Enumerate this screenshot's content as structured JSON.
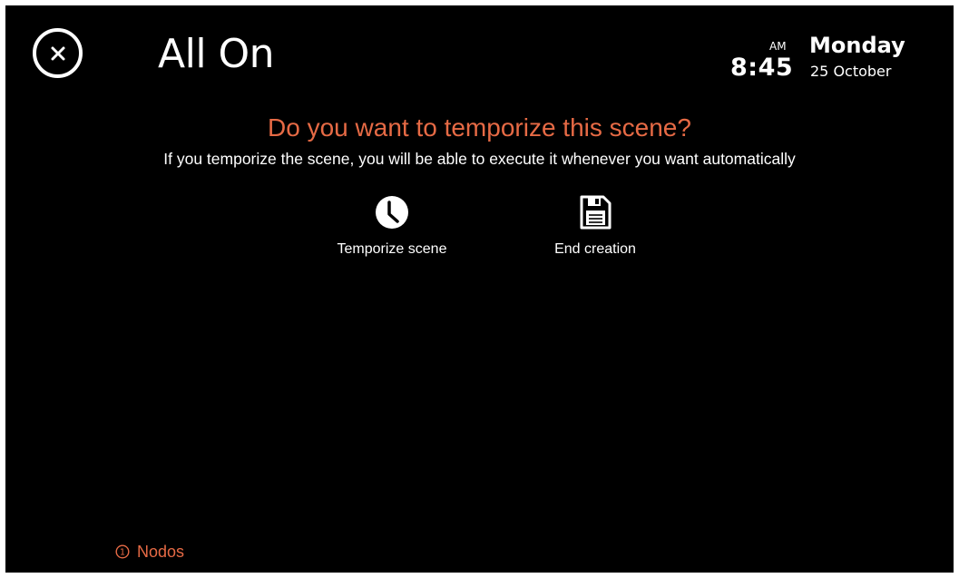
{
  "header": {
    "title": "All On",
    "close_icon": "close-icon"
  },
  "clock": {
    "ampm": "AM",
    "time": "8:45",
    "day": "Monday",
    "date": "25 October"
  },
  "prompt": {
    "question": "Do you want to temporize this scene?",
    "description": "If you temporize the scene, you will be able to execute it whenever you want automatically"
  },
  "actions": [
    {
      "label": "Temporize scene",
      "icon": "clock-icon"
    },
    {
      "label": "End creation",
      "icon": "save-icon"
    }
  ],
  "footer": {
    "nodos_label": "Nodos",
    "nodos_icon": "info-icon"
  },
  "colors": {
    "background": "#000000",
    "accent": "#e66a45",
    "text": "#ffffff"
  }
}
